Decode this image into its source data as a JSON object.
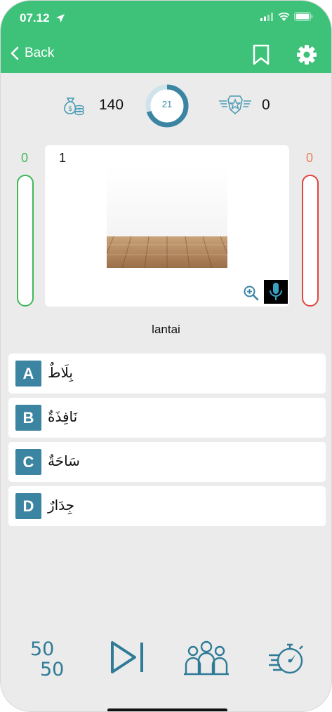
{
  "status": {
    "time": "07.12"
  },
  "nav": {
    "back_label": "Back"
  },
  "stats": {
    "coins": "140",
    "timer": "21",
    "score": "0",
    "timer_progress": 0.7
  },
  "meters": {
    "correct": "0",
    "wrong": "0"
  },
  "question": {
    "number": "1",
    "word": "lantai"
  },
  "options": [
    {
      "letter": "A",
      "text": "بِلَاطٌ"
    },
    {
      "letter": "B",
      "text": "نَافِذَةٌ"
    },
    {
      "letter": "C",
      "text": "سَاحَةٌ"
    },
    {
      "letter": "D",
      "text": "جِدَارٌ"
    }
  ],
  "colors": {
    "header": "#3ec27a",
    "accent": "#3b84a2",
    "correct": "#3eb858",
    "wrong": "#e0453f"
  },
  "icons": {
    "money": "money-bag-icon",
    "badge": "star-badge-icon",
    "bottom": [
      "fifty-fifty-icon",
      "skip-icon",
      "audience-icon",
      "timer-boost-icon"
    ]
  }
}
